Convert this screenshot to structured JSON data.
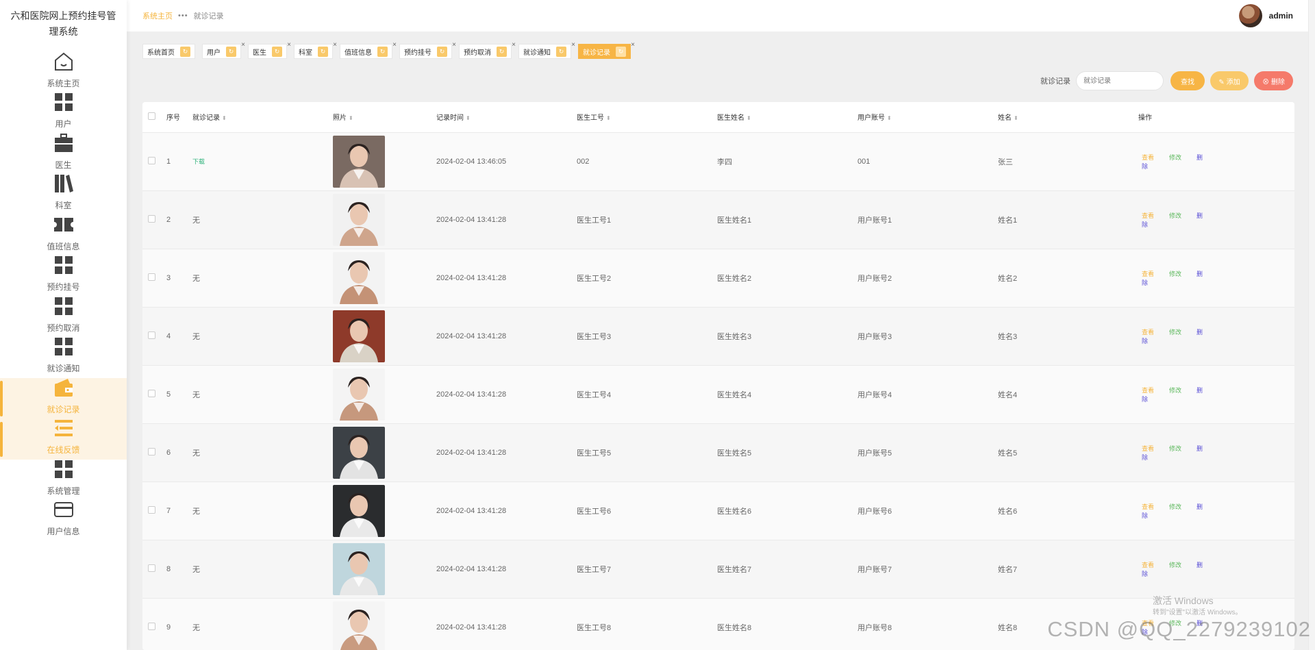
{
  "sidebar": {
    "title": "六和医院网上预约挂号管理系统",
    "items": [
      {
        "label": "系统主页",
        "icon": "home-icon"
      },
      {
        "label": "用户",
        "icon": "grid-icon"
      },
      {
        "label": "医生",
        "icon": "briefcase-icon"
      },
      {
        "label": "科室",
        "icon": "books-icon"
      },
      {
        "label": "值班信息",
        "icon": "ticket-icon"
      },
      {
        "label": "预约挂号",
        "icon": "grid-icon"
      },
      {
        "label": "预约取消",
        "icon": "grid-icon"
      },
      {
        "label": "就诊通知",
        "icon": "grid-icon"
      },
      {
        "label": "就诊记录",
        "icon": "wallet-icon"
      },
      {
        "label": "在线反馈",
        "icon": "list-icon"
      },
      {
        "label": "系统管理",
        "icon": "grid-icon"
      },
      {
        "label": "用户信息",
        "icon": "card-icon"
      }
    ]
  },
  "header": {
    "breadcrumb_home": "系统主页",
    "breadcrumb_current": "就诊记录",
    "username": "admin"
  },
  "tabs": [
    {
      "label": "系统首页"
    },
    {
      "label": "用户"
    },
    {
      "label": "医生"
    },
    {
      "label": "科室"
    },
    {
      "label": "值班信息"
    },
    {
      "label": "预约挂号"
    },
    {
      "label": "预约取消"
    },
    {
      "label": "就诊通知"
    },
    {
      "label": "就诊记录"
    }
  ],
  "search": {
    "label": "就诊记录",
    "placeholder": "就诊记录",
    "search_btn": "查找",
    "add_btn": "添加",
    "delete_btn": "删除"
  },
  "table": {
    "columns": [
      "序号",
      "就诊记录",
      "照片",
      "记录时间",
      "医生工号",
      "医生姓名",
      "用户账号",
      "姓名",
      "操作"
    ],
    "actions": {
      "view": "查看",
      "edit": "修改",
      "delete": "删除"
    },
    "rows": [
      {
        "no": "1",
        "record": "下载",
        "time": "2024-02-04 13:46:05",
        "doctor_id": "002",
        "doctor_name": "李四",
        "user_account": "001",
        "name": "张三",
        "photo_colors": [
          "#7a6a62",
          "#d8c2b4"
        ]
      },
      {
        "no": "2",
        "record": "无",
        "time": "2024-02-04 13:41:28",
        "doctor_id": "医生工号1",
        "doctor_name": "医生姓名1",
        "user_account": "用户账号1",
        "name": "姓名1",
        "photo_colors": [
          "#f1f1f1",
          "#cfa58c"
        ]
      },
      {
        "no": "3",
        "record": "无",
        "time": "2024-02-04 13:41:28",
        "doctor_id": "医生工号2",
        "doctor_name": "医生姓名2",
        "user_account": "用户账号2",
        "name": "姓名2",
        "photo_colors": [
          "#f3f3f3",
          "#c49276"
        ]
      },
      {
        "no": "4",
        "record": "无",
        "time": "2024-02-04 13:41:28",
        "doctor_id": "医生工号3",
        "doctor_name": "医生姓名3",
        "user_account": "用户账号3",
        "name": "姓名3",
        "photo_colors": [
          "#8e3a2a",
          "#d9d2c6"
        ]
      },
      {
        "no": "5",
        "record": "无",
        "time": "2024-02-04 13:41:28",
        "doctor_id": "医生工号4",
        "doctor_name": "医生姓名4",
        "user_account": "用户账号4",
        "name": "姓名4",
        "photo_colors": [
          "#f4f4f4",
          "#c6987d"
        ]
      },
      {
        "no": "6",
        "record": "无",
        "time": "2024-02-04 13:41:28",
        "doctor_id": "医生工号5",
        "doctor_name": "医生姓名5",
        "user_account": "用户账号5",
        "name": "姓名5",
        "photo_colors": [
          "#3c4146",
          "#e3e3e3"
        ]
      },
      {
        "no": "7",
        "record": "无",
        "time": "2024-02-04 13:41:28",
        "doctor_id": "医生工号6",
        "doctor_name": "医生姓名6",
        "user_account": "用户账号6",
        "name": "姓名6",
        "photo_colors": [
          "#2a2c2e",
          "#e9e9e9"
        ]
      },
      {
        "no": "8",
        "record": "无",
        "time": "2024-02-04 13:41:28",
        "doctor_id": "医生工号7",
        "doctor_name": "医生姓名7",
        "user_account": "用户账号7",
        "name": "姓名7",
        "photo_colors": [
          "#bfd6dd",
          "#e8e8e8"
        ]
      },
      {
        "no": "9",
        "record": "无",
        "time": "2024-02-04 13:41:28",
        "doctor_id": "医生工号8",
        "doctor_name": "医生姓名8",
        "user_account": "用户账号8",
        "name": "姓名8",
        "photo_colors": [
          "#f5f5f5",
          "#c99b80"
        ]
      }
    ]
  },
  "watermarks": {
    "windows_line1": "激活 Windows",
    "windows_line2": "转到\"设置\"以激活 Windows。",
    "csdn": "CSDN @QQ_2279239102"
  },
  "colors": {
    "accent": "#f5b43c",
    "edit": "#5cb85c",
    "delete_link": "#5a4fd6",
    "delete_btn": "#f57a6a",
    "download_link": "#2fb27b"
  }
}
